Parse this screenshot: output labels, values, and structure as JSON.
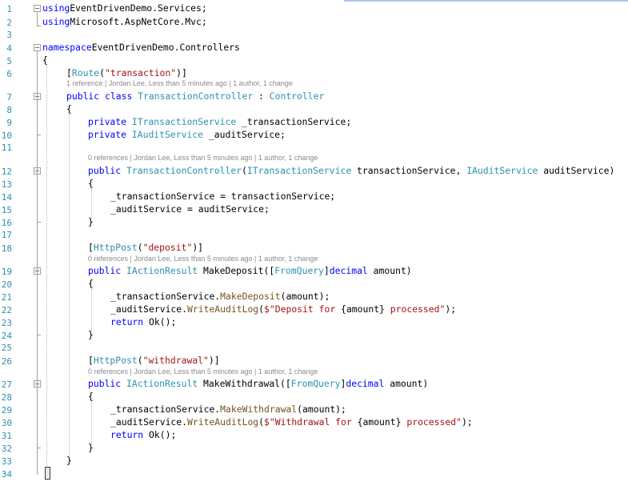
{
  "editor": {
    "line_numbers": [
      "1",
      "2",
      "3",
      "4",
      "5",
      "6",
      "7",
      "8",
      "9",
      "10",
      "11",
      "12",
      "13",
      "14",
      "15",
      "16",
      "17",
      "18",
      "19",
      "20",
      "21",
      "22",
      "23",
      "24",
      "25",
      "26",
      "27",
      "28",
      "29",
      "30",
      "31",
      "32",
      "33",
      "34"
    ],
    "lines": [
      [
        [
          "kw",
          "using"
        ],
        [
          "",
          "EventDrivenDemo.Services;"
        ]
      ],
      [
        [
          "kw",
          "using"
        ],
        [
          "",
          "Microsoft.AspNetCore.Mvc;"
        ]
      ],
      [],
      [
        [
          "kw",
          "namespace"
        ],
        [
          "",
          "EventDrivenDemo.Controllers"
        ]
      ],
      [
        [
          "",
          "{"
        ]
      ],
      [
        [
          "",
          "["
        ],
        [
          "ty",
          "Route"
        ],
        [
          "",
          "("
        ],
        [
          "st",
          "\"transaction\""
        ],
        [
          "",
          ")]"
        ]
      ],
      [
        [
          "kw",
          "public"
        ],
        [
          "",
          " "
        ],
        [
          "kw",
          "class"
        ],
        [
          "",
          " "
        ],
        [
          "ty",
          "TransactionController"
        ],
        [
          "",
          " : "
        ],
        [
          "ty",
          "Controller"
        ]
      ],
      [
        [
          "",
          "{"
        ]
      ],
      [
        [
          "kw",
          "private"
        ],
        [
          "",
          " "
        ],
        [
          "ty",
          "ITransactionService"
        ],
        [
          "",
          " _transactionService;"
        ]
      ],
      [
        [
          "kw",
          "private"
        ],
        [
          "",
          " "
        ],
        [
          "ty",
          "IAuditService"
        ],
        [
          "",
          " _auditService;"
        ]
      ],
      [],
      [
        [
          "kw",
          "public"
        ],
        [
          "",
          " "
        ],
        [
          "ty",
          "TransactionController"
        ],
        [
          "",
          "("
        ],
        [
          "ty",
          "ITransactionService"
        ],
        [
          "",
          " transactionService, "
        ],
        [
          "ty",
          "IAuditService"
        ],
        [
          "",
          " auditService)"
        ]
      ],
      [
        [
          "",
          "{"
        ]
      ],
      [
        [
          "",
          "_transactionService = transactionService;"
        ]
      ],
      [
        [
          "",
          "_auditService = auditService;"
        ]
      ],
      [
        [
          "",
          "}"
        ]
      ],
      [],
      [
        [
          "",
          "["
        ],
        [
          "ty",
          "HttpPost"
        ],
        [
          "",
          "("
        ],
        [
          "st",
          "\"deposit\""
        ],
        [
          "",
          ")]"
        ]
      ],
      [
        [
          "kw",
          "public"
        ],
        [
          "",
          " "
        ],
        [
          "ty",
          "IActionResult"
        ],
        [
          "",
          " MakeDeposit(["
        ],
        [
          "ty",
          "FromQuery"
        ],
        [
          "",
          "]"
        ],
        [
          "kw",
          "decimal"
        ],
        [
          "",
          " amount)"
        ]
      ],
      [
        [
          "",
          "{"
        ]
      ],
      [
        [
          "",
          "_transactionService."
        ],
        [
          "mt",
          "MakeDeposit"
        ],
        [
          "",
          "(amount);"
        ]
      ],
      [
        [
          "",
          "_auditService."
        ],
        [
          "mt",
          "WriteAuditLog"
        ],
        [
          "",
          "("
        ],
        [
          "st",
          "$\"Deposit for "
        ],
        [
          "",
          "{amount}"
        ],
        [
          "st",
          " processed\""
        ],
        [
          "",
          ");"
        ]
      ],
      [
        [
          "kw",
          "return"
        ],
        [
          "",
          " Ok();"
        ]
      ],
      [
        [
          "",
          "}"
        ]
      ],
      [],
      [
        [
          "",
          "["
        ],
        [
          "ty",
          "HttpPost"
        ],
        [
          "",
          "("
        ],
        [
          "st",
          "\"withdrawal\""
        ],
        [
          "",
          ")]"
        ]
      ],
      [
        [
          "kw",
          "public"
        ],
        [
          "",
          " "
        ],
        [
          "ty",
          "IActionResult"
        ],
        [
          "",
          " MakeWithdrawal(["
        ],
        [
          "ty",
          "FromQuery"
        ],
        [
          "",
          "]"
        ],
        [
          "kw",
          "decimal"
        ],
        [
          "",
          " amount)"
        ]
      ],
      [
        [
          "",
          "{"
        ]
      ],
      [
        [
          "",
          "_transactionService."
        ],
        [
          "mt",
          "MakeWithdrawal"
        ],
        [
          "",
          "(amount);"
        ]
      ],
      [
        [
          "",
          "_auditService."
        ],
        [
          "mt",
          "WriteAuditLog"
        ],
        [
          "",
          "("
        ],
        [
          "st",
          "$\"Withdrawal for "
        ],
        [
          "",
          "{amount}"
        ],
        [
          "st",
          " processed\""
        ],
        [
          "",
          ");"
        ]
      ],
      [
        [
          "kw",
          "return"
        ],
        [
          "",
          " Ok();"
        ]
      ],
      [
        [
          "",
          "}"
        ]
      ],
      [
        [
          "",
          "}"
        ]
      ],
      [
        [
          "",
          "}"
        ]
      ]
    ],
    "codelens": [
      "1 reference | Jordan Lee, Less than 5 minutes ago | 1 author, 1 change",
      "0 references | Jordan Lee, Less than 5 minutes ago | 1 author, 1 change",
      "0 references | Jordan Lee, Less than 5 minutes ago | 1 author, 1 change",
      "0 references | Jordan Lee, Less than 5 minutes ago | 1 author, 1 change"
    ]
  }
}
